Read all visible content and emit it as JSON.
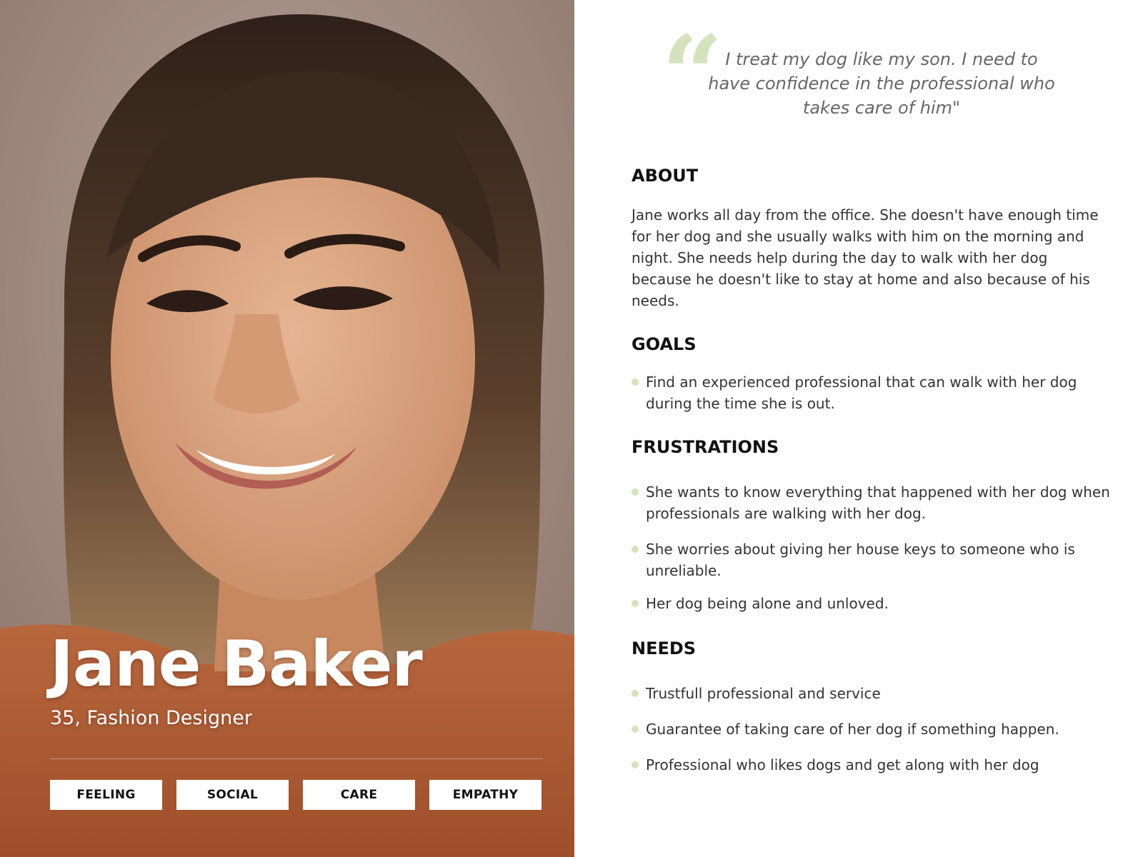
{
  "persona": {
    "name": "Jane Baker",
    "subtitle": "35, Fashion Designer",
    "tags": [
      "FEELING",
      "SOCIAL",
      "CARE",
      "EMPATHY"
    ]
  },
  "quote": {
    "mark": "“",
    "text": "I treat my dog like my son. I need to have confidence in the professional who takes care of him\""
  },
  "about": {
    "title": "ABOUT",
    "text": "Jane works all day from the office.  She doesn't have enough time for her dog and she usually walks with him on the morning and night.  She needs help during the day to walk with her dog because he doesn't like to stay at home and also because of his needs."
  },
  "goals": {
    "title": "GOALS",
    "items": [
      "Find an experienced professional that can walk with her dog during the time she is out."
    ]
  },
  "frustrations": {
    "title": "FRUSTRATIONS",
    "items": [
      "She wants to know everything that happened with her dog when professionals are walking with her dog.",
      "She worries about giving her house keys to someone who is unreliable.",
      "Her dog being alone and unloved."
    ]
  },
  "needs": {
    "title": "NEEDS",
    "items": [
      "Trustfull professional and service",
      "Guarantee of taking care of her dog if something happen.",
      "Professional who likes dogs and get along with her dog"
    ]
  },
  "colors": {
    "accent": "#d4e3bd",
    "sweater": "#b25f35",
    "skin": "#d9a47f",
    "hair": "#3b2a20"
  }
}
